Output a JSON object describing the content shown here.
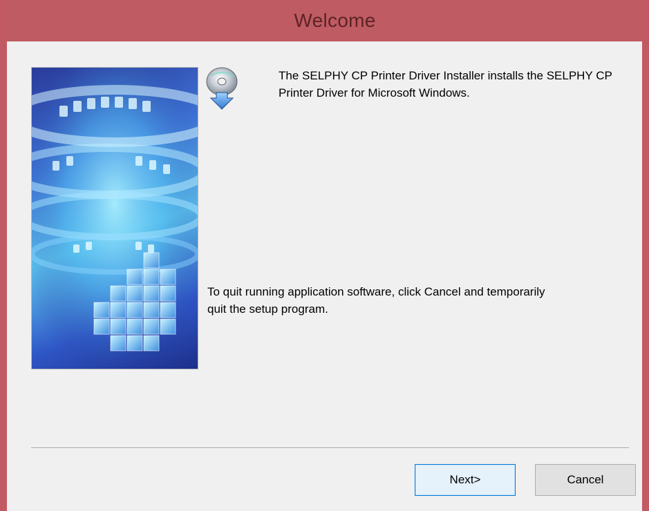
{
  "window": {
    "title": "Welcome",
    "accent_color": "#bf5b63"
  },
  "content": {
    "intro_text": "The SELPHY CP Printer Driver Installer installs the SELPHY CP Printer Driver for Microsoft Windows.",
    "quit_text": "To quit running application software, click Cancel and temporarily quit the setup program.",
    "banner_icon": "canon-setup-banner",
    "setup_icon": "cd-install-icon"
  },
  "buttons": {
    "next_label": "Next>",
    "cancel_label": "Cancel"
  }
}
